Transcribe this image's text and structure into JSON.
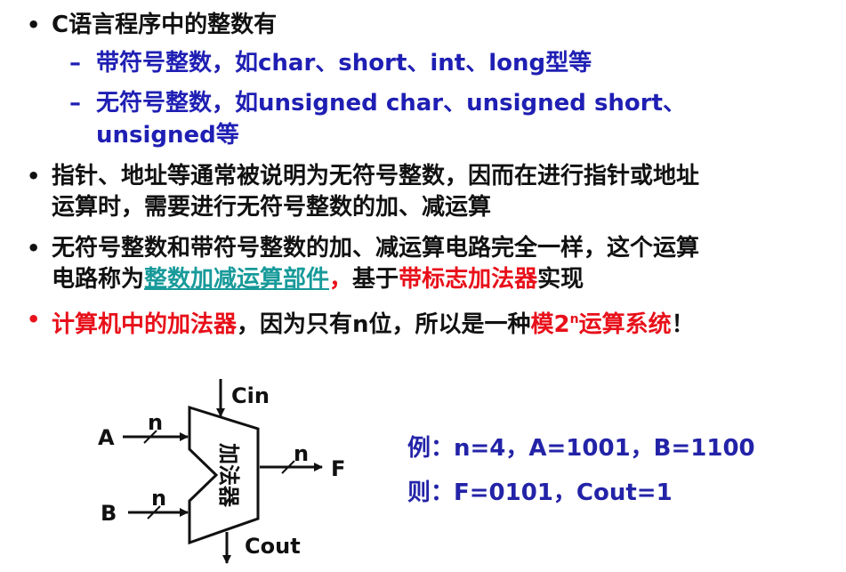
{
  "bullets": [
    {
      "text": "C语言程序中的整数有"
    },
    {
      "sub": [
        "带符号整数，如char、short、int、long型等",
        "无符号整数，如unsigned char、unsigned short、",
        "unsigned等"
      ]
    },
    {
      "line1": "指针、地址等通常被说明为无符号整数，因而在进行指针或地址",
      "line2": "运算时，需要进行无符号整数的加、减运算"
    },
    {
      "line1": "无符号整数和带符号整数的加、减运算电路完全一样，这个运算",
      "line2_a": "电路称为",
      "line2_link": "整数加减运算部件",
      "line2_b": "，",
      "line2_c": "基于",
      "line2_d": "带标志加法器",
      "line2_e": "实现"
    },
    {
      "a": "计算机中的加法器",
      "b": "，因为只有n位，所以是一种",
      "c": "模2",
      "c_sup": "n",
      "d": "运算系统",
      "e": "！"
    }
  ],
  "bullet_symbol": "•",
  "dash_symbol": "–",
  "diagram": {
    "adder_label": "加法器",
    "cin": "Cin",
    "cout": "Cout",
    "input_a": "A",
    "input_b": "B",
    "output_f": "F",
    "width_label": "n"
  },
  "example": {
    "line1": "例：n=4，A=1001，B=1100",
    "line2": "则：F=0101，Cout=1"
  },
  "colors": {
    "blue": "#1f1fb4",
    "red": "#e8101a",
    "teal": "#189a9a",
    "text": "#111111"
  }
}
